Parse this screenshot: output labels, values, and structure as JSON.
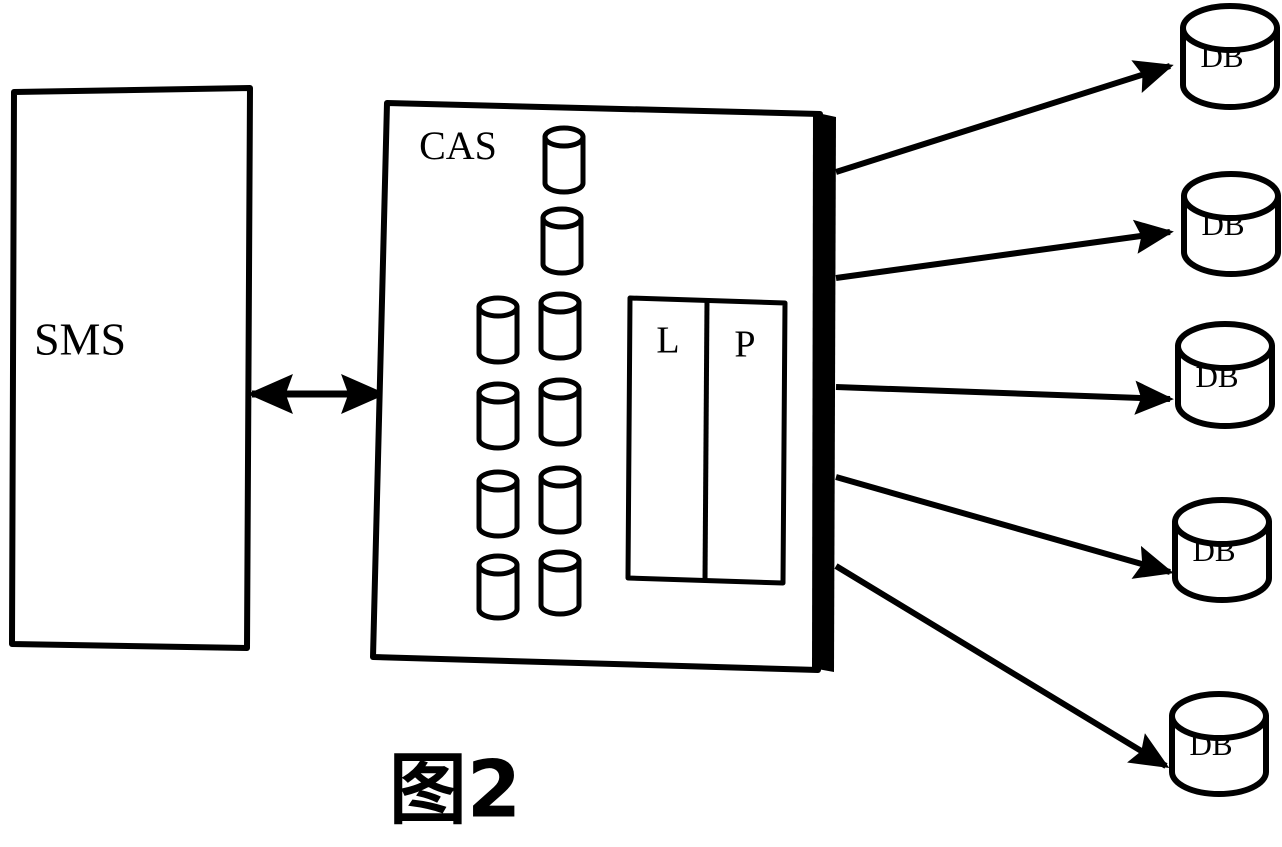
{
  "figure": {
    "caption": "图2",
    "type": "system-architecture-diagram"
  },
  "nodes": {
    "sms": {
      "label": "SMS",
      "shape": "rectangle"
    },
    "cas": {
      "label": "CAS",
      "shape": "rectangle-with-thick-right-edge",
      "internal_cylinder_count": 10,
      "table": {
        "columns": [
          {
            "label": "L"
          },
          {
            "label": "P"
          }
        ]
      }
    },
    "databases": [
      {
        "label": "DB"
      },
      {
        "label": "DB"
      },
      {
        "label": "DB"
      },
      {
        "label": "DB"
      },
      {
        "label": "DB"
      }
    ]
  },
  "connections": {
    "sms_cas": {
      "direction": "bidirectional",
      "from": "SMS",
      "to": "CAS"
    },
    "cas_db": {
      "direction": "unidirectional",
      "from": "CAS",
      "to": "DB",
      "count": 5
    }
  },
  "colors": {
    "stroke": "#000000",
    "fill": "#ffffff",
    "bar": "#000000"
  }
}
